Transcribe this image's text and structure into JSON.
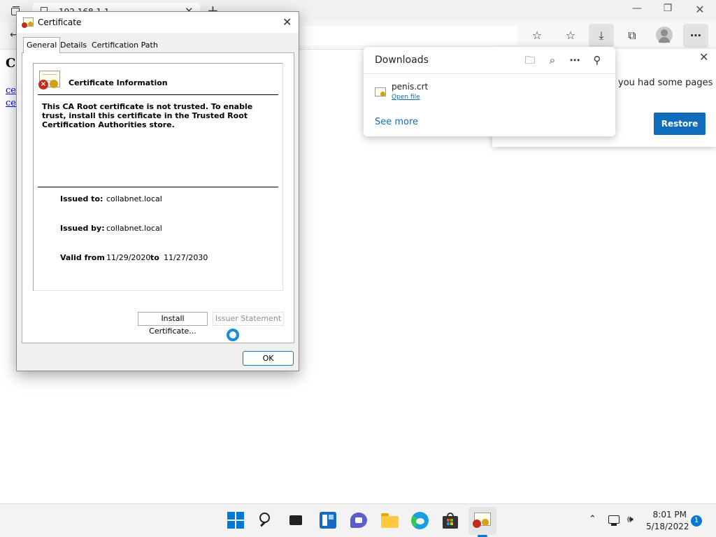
{
  "browser": {
    "tab_title": "192.168.1.1",
    "tab_close": "✕",
    "new_tab": "+",
    "minimize": "—",
    "maximize": "❐",
    "close": "✕",
    "back": "←",
    "icons": {
      "favorite_add": "☆",
      "favorites": "☆",
      "downloads": "⤓",
      "collections": "⧉",
      "more": "⋯"
    }
  },
  "page": {
    "heading": "Ce",
    "links": [
      "cer",
      "cer"
    ]
  },
  "restore_popup": {
    "message": "you had some pages",
    "close": "✕",
    "restore_label": "Restore"
  },
  "downloads": {
    "title": "Downloads",
    "icons": {
      "folder": "🗀",
      "search": "⌕",
      "more": "⋯",
      "pin": "⚲"
    },
    "item": {
      "file_name": "penis.crt",
      "action": "Open file"
    },
    "see_more": "See more"
  },
  "certificate": {
    "title": "Certificate",
    "close": "✕",
    "tabs": [
      "General",
      "Details",
      "Certification Path"
    ],
    "info_heading": "Certificate Information",
    "warning": "This CA Root certificate is not trusted. To enable trust, install this certificate in the Trusted Root Certification Authorities store.",
    "issued_to_label": "Issued to:",
    "issued_to": "collabnet.local",
    "issued_by_label": "Issued by:",
    "issued_by": "collabnet.local",
    "valid_from_label": "Valid from",
    "valid_from": "11/29/2020",
    "valid_to_label": "to",
    "valid_to": "11/27/2030",
    "install_button": "Install Certificate...",
    "issuer_statement_button": "Issuer Statement",
    "ok_button": "OK"
  },
  "taskbar": {
    "tray_chevron": "⌃",
    "volume": "🕪",
    "time": "8:01 PM",
    "date": "5/18/2022",
    "notification_count": "1"
  },
  "colors": {
    "accent": "#0078d4",
    "restore_button": "#0f6cbd",
    "error_red": "#c42b1c"
  }
}
